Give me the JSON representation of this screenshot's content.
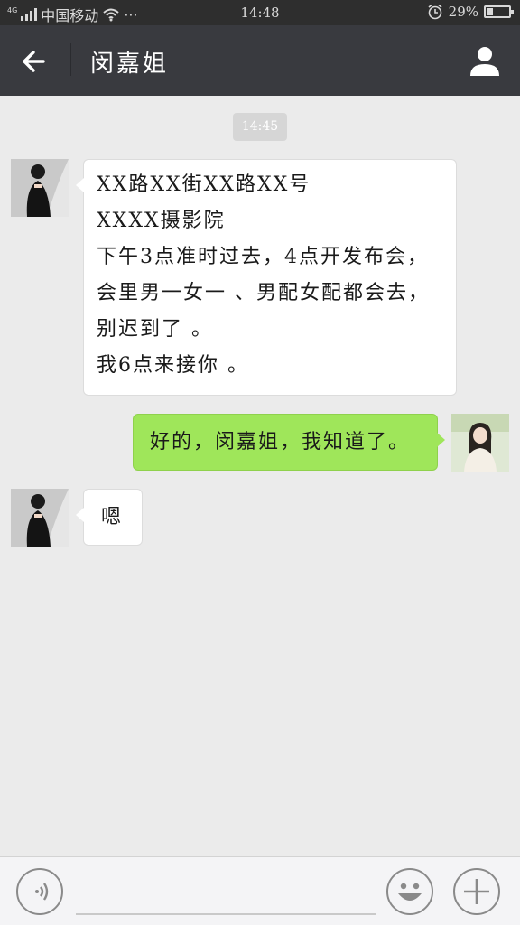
{
  "status_bar": {
    "network_type": "4G",
    "carrier": "中国移动",
    "more": "···",
    "time": "14:48",
    "battery_percent": "29%",
    "battery_level": 0.29
  },
  "header": {
    "title": "闵嘉姐"
  },
  "chat": {
    "timestamp": "14:45",
    "messages": [
      {
        "direction": "incoming",
        "lines": [
          "XX路XX街XX路XX号",
          "XXXX摄影院",
          "下午3点准时过去，4点开发布会，",
          "会里男一女一 、男配女配都会去，",
          "别迟到了 。",
          "我6点来接你 。"
        ]
      },
      {
        "direction": "outgoing",
        "lines": [
          "好的，闵嘉姐，我知道了。"
        ]
      },
      {
        "direction": "incoming",
        "lines": [
          "嗯"
        ]
      }
    ]
  },
  "input_bar": {
    "text": ""
  },
  "icons": {
    "back": "arrow-left-icon",
    "profile": "person-icon",
    "voice": "voice-icon",
    "emoji": "smiley-icon",
    "more": "plus-icon"
  },
  "colors": {
    "header_bg": "#393a3f",
    "chat_bg": "#ebebeb",
    "outgoing_bubble": "#9fe65a",
    "incoming_bubble": "#ffffff"
  }
}
